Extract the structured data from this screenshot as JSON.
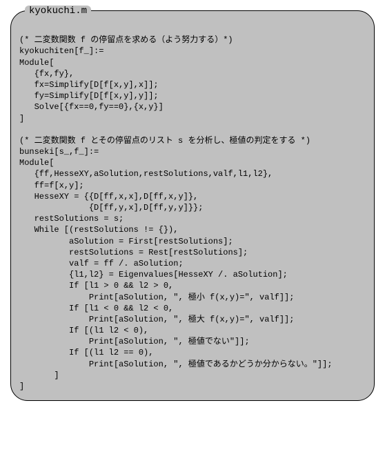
{
  "title": "kyokuchi.m",
  "code": "\n(* 二変数関数 f の停留点を求める（よう努力する）*)\nkyokuchiten[f_]:=\nModule[\n   {fx,fy},\n   fx=Simplify[D[f[x,y],x]];\n   fy=Simplify[D[f[x,y],y]];\n   Solve[{fx==0,fy==0},{x,y}]\n]\n\n(* 二変数関数 f とその停留点のリスト s を分析し、極値の判定をする *)\nbunseki[s_,f_]:=\nModule[\n   {ff,HesseXY,aSolution,restSolutions,valf,l1,l2},\n   ff=f[x,y];\n   HesseXY = {{D[ff,x,x],D[ff,x,y]},\n              {D[ff,y,x],D[ff,y,y]}};\n   restSolutions = s;\n   While [(restSolutions != {}),\n          aSolution = First[restSolutions];\n          restSolutions = Rest[restSolutions];\n          valf = ff /. aSolution;\n          {l1,l2} = Eigenvalues[HesseXY /. aSolution];\n          If [l1 > 0 && l2 > 0,\n              Print[aSolution, \", 極小 f(x,y)=\", valf]];\n          If [l1 < 0 && l2 < 0,\n              Print[aSolution, \", 極大 f(x,y)=\", valf]];\n          If [(l1 l2 < 0),\n              Print[aSolution, \", 極値でない\"]];\n          If [(l1 l2 == 0),\n              Print[aSolution, \", 極値であるかどうか分からない。\"]];\n       ]\n]"
}
